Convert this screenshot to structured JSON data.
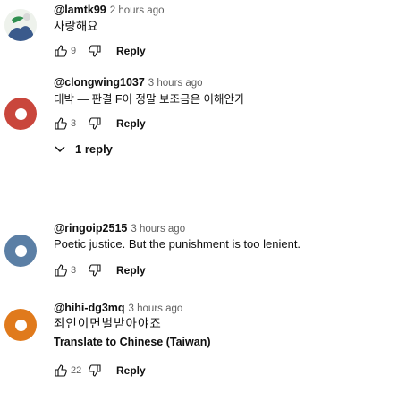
{
  "comments": [
    {
      "user": "@lamtk99",
      "time": "2 hours ago",
      "text": "사랑해요",
      "likes": "9",
      "reply_label": "Reply",
      "avatar": "image-avatar"
    },
    {
      "user": "@clongwing1037",
      "time": "3 hours ago",
      "text": "대박 — 판결 F이 정말 보조금은 이해안가",
      "likes": "3",
      "reply_label": "Reply",
      "replies_label": "1 reply",
      "avatar_color": "#c9463c"
    },
    {
      "user": "@ringoip2515",
      "time": "3 hours ago",
      "text": "Poetic justice. But the punishment is too lenient.",
      "likes": "3",
      "reply_label": "Reply",
      "avatar_color": "#5b7fa5"
    },
    {
      "user": "@hihi-dg3mq",
      "time": "3 hours ago",
      "text": "죄인이면벌받아야죠",
      "translate_label": "Translate to Chinese (Taiwan)",
      "likes": "22",
      "reply_label": "Reply",
      "avatar_color": "#e07a1c"
    }
  ]
}
